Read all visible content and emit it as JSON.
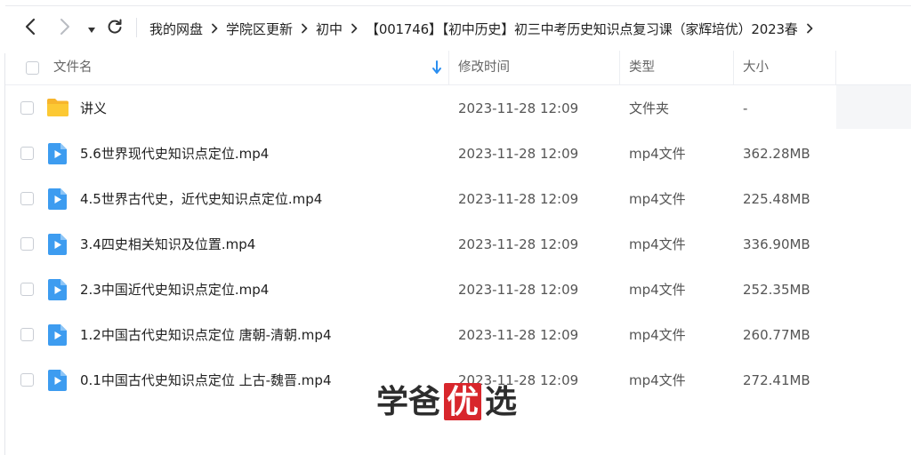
{
  "nav": {
    "back_icon": "chevron-left-icon",
    "forward_icon": "chevron-right-icon",
    "history_icon": "caret-down-icon",
    "refresh_icon": "refresh-icon"
  },
  "breadcrumb": [
    "我的网盘",
    "学院区更新",
    "初中",
    "【001746】【初中历史】初三中考历史知识点复习课（家辉培优）2023春"
  ],
  "columns": {
    "name": "文件名",
    "modified": "修改时间",
    "type": "类型",
    "size": "大小",
    "sort_icon": "sort-down-arrow-icon"
  },
  "files": [
    {
      "icon": "folder-icon",
      "name": "讲义",
      "modified": "2023-11-28 12:09",
      "type": "文件夹",
      "size": "-"
    },
    {
      "icon": "video-file-icon",
      "name": "5.6世界现代史知识点定位.mp4",
      "modified": "2023-11-28 12:09",
      "type": "mp4文件",
      "size": "362.28MB"
    },
    {
      "icon": "video-file-icon",
      "name": "4.5世界古代史，近代史知识点定位.mp4",
      "modified": "2023-11-28 12:09",
      "type": "mp4文件",
      "size": "225.48MB"
    },
    {
      "icon": "video-file-icon",
      "name": "3.4四史相关知识及位置.mp4",
      "modified": "2023-11-28 12:09",
      "type": "mp4文件",
      "size": "336.90MB"
    },
    {
      "icon": "video-file-icon",
      "name": "2.3中国近代史知识点定位.mp4",
      "modified": "2023-11-28 12:09",
      "type": "mp4文件",
      "size": "252.35MB"
    },
    {
      "icon": "video-file-icon",
      "name": "1.2中国古代史知识点定位 唐朝-清朝.mp4",
      "modified": "2023-11-28 12:09",
      "type": "mp4文件",
      "size": "260.77MB"
    },
    {
      "icon": "video-file-icon",
      "name": "0.1中国古代史知识点定位 上古-魏晋.mp4",
      "modified": "2023-11-28 12:09",
      "type": "mp4文件",
      "size": "272.41MB"
    }
  ],
  "watermark": {
    "chars": [
      "学",
      "爸",
      "优",
      "选"
    ],
    "highlight_color": "#d8262c"
  },
  "colors": {
    "accent": "#2b8ef0",
    "folder": "#fbc02d",
    "video_icon": "#3d9cf0"
  }
}
